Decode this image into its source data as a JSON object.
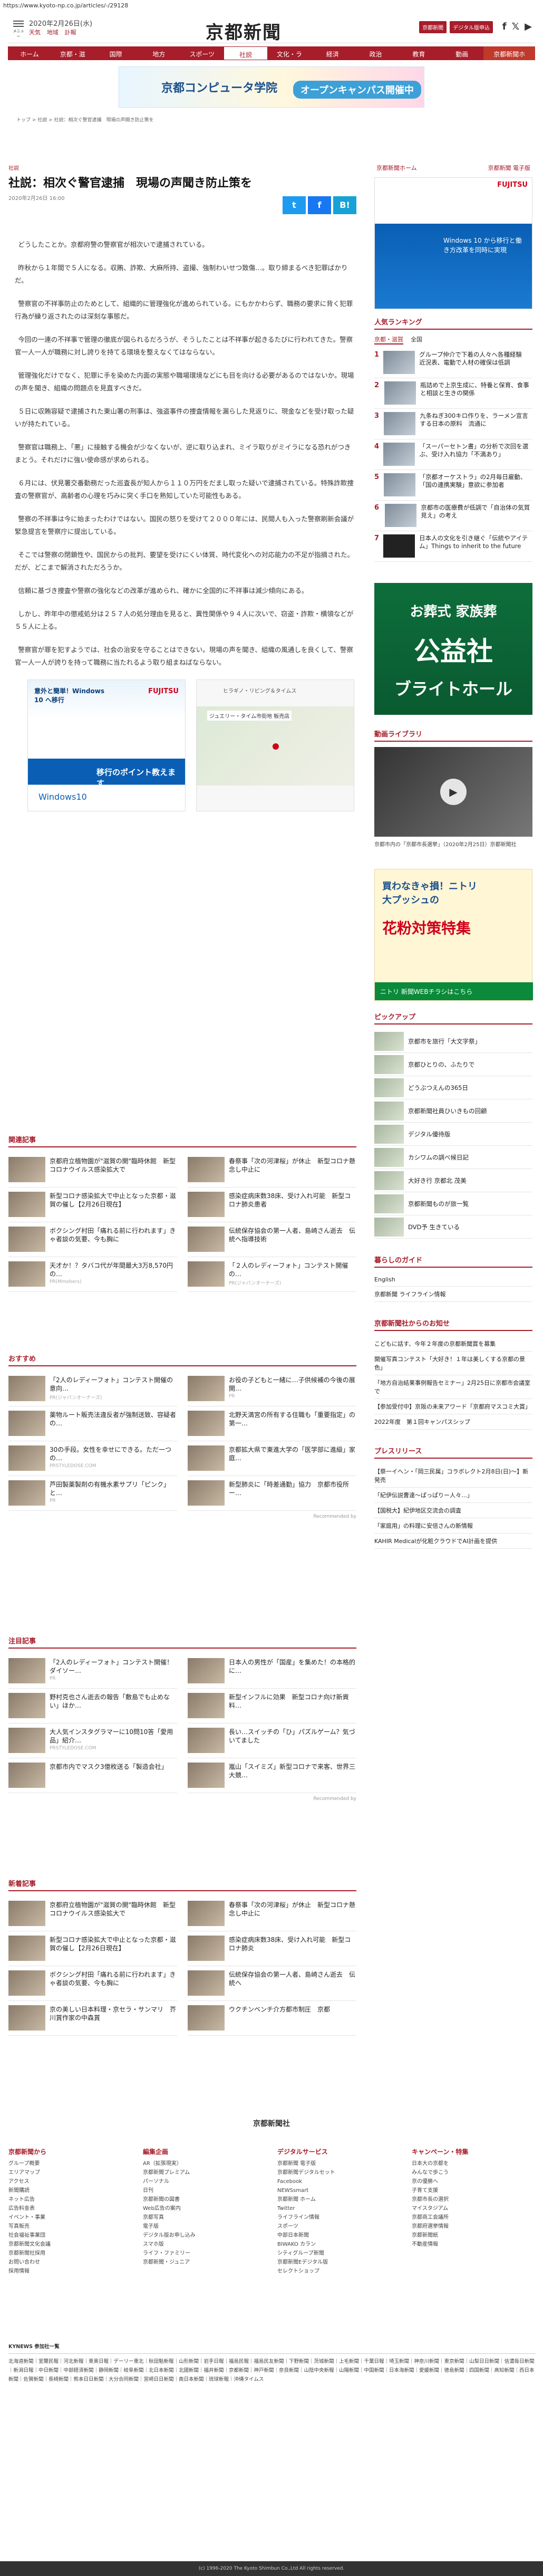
{
  "url": "https://www.kyoto-np.co.jp/articles/-/29128",
  "header": {
    "menu_label": "メニュー",
    "date": "2020年2月26日(水)",
    "links": [
      "天気",
      "地域",
      "訃報"
    ],
    "logo": "京都新聞",
    "btn_mypage": "京都新聞",
    "btn_digital": "デジタル版申込",
    "sns": [
      "f",
      "𝕏",
      "▶"
    ]
  },
  "nav": [
    "ホーム",
    "京都・滋賀",
    "国際",
    "地方",
    "スポーツ",
    "社説",
    "文化・ライフ",
    "経済",
    "政治",
    "教育",
    "動画",
    "京都新聞ホーム"
  ],
  "banner": {
    "left": "京都コンピュータ学院",
    "right": "オープンキャンパス開催中"
  },
  "breadcrumb": "トップ > 社説 > 社説：相次ぐ警官逮捕　現場の声聞き防止策を",
  "article": {
    "category": "社説",
    "title": "社説：相次ぐ警官逮捕　現場の声聞き防止策を",
    "date": "2020年2月26日 16:00",
    "share": [
      "t",
      "f",
      "B!"
    ],
    "paragraphs": [
      "どうしたことか。京都府警の警察官が相次いで逮捕されている。",
      "昨秋から１年間で５人になる。収賄、詐欺、大麻所持、盗撮、強制わいせつ致傷…。取り締まるべき犯罪ばかりだ。",
      "警察官の不祥事防止のためとして、組織的に管理強化が進められている。にもかかわらず、職務の要求に背く犯罪行為が繰り返されたのは深刻な事態だ。",
      "今回の一連の不祥事で管理の徹底が図られるだろうが、そうしたことは不祥事が起きるたびに行われてきた。警察官一人一人が職務に対し誇りを持てる環境を整えなくてはならない。",
      "管理強化だけでなく、犯罪に手を染めた内面の実態や職場環境などにも目を向ける必要があるのではないか。現場の声を聞き、組織の問題点を見直すべきだ。",
      "５日に収賄容疑で逮捕された東山署の刑事は、強盗事件の捜査情報を漏らした見返りに、現金などを受け取った疑いが持たれている。",
      "警察官は職務上、「悪」に接触する機会が少なくないが、逆に取り込まれ、ミイラ取りがミイラになる恐れがつきまとう。それだけに強い使命感が求められる。",
      "６月には、伏見署交番勤務だった巡査長が知人から１１０万円をだまし取った疑いで逮捕されている。特殊詐欺捜査の警察官が、高齢者の心理を巧みに突く手口を熟知していた可能性もある。",
      "警察の不祥事は今に始まったわけではない。国民の怒りを受けて２０００年には、民間人も入った警察刷新会議が緊急提言を警察庁に提出している。",
      "そこでは警察の閉鎖性や、国民からの批判、要望を受けにくい体質、時代変化への対応能力の不足が指摘された。だが、どこまで解消されただろうか。",
      "信頼に基づき捜査や警察の強化などの改革が進められ、確かに全国的に不祥事は減少傾向にある。",
      "しかし、昨年中の懲戒処分は２５７人の処分理由を見ると、異性関係や９４人に次いで、窃盗・詐欺・横領などが５５人に上る。",
      "警察官が罪を犯すようでは、社会の治安を守ることはできない。現場の声を聞き、組織の風通しを良くして、警察官一人一人が誇りを持って職務に当たれるよう取り組まねばならない。"
    ]
  },
  "ads": {
    "ad1_top": "意外と簡単！Windows 10 へ移行",
    "ad1_brand": "FUJITSU",
    "ad1_mid": "移行のポイント教えます",
    "ad1_bottom": "Windows10",
    "ad2_title": "ヒラギノ・リビング＆タイムス",
    "ad2_sub": "ジュエリー・タイム市街地 販売店"
  },
  "related": {
    "heading": "関連記事",
    "items": [
      {
        "t": "京都府立植物園が\"滋賀の開\"臨時休館　新型コロナウイルス感染拡大で",
        "s": ""
      },
      {
        "t": "春祭事「次の河津桜」が休止　新型コロナ懸念し中止に",
        "s": ""
      },
      {
        "t": "新型コロナ感染拡大で中止となった京都・滋賀の催し【2月26日現在】",
        "s": ""
      },
      {
        "t": "感染症病床数38床、受け入れ可能　新型コロナ肺炎患者",
        "s": ""
      },
      {
        "t": "ボクシング村田「痛れる前に行われます」きゃ者談の気要、今も胸に",
        "s": ""
      },
      {
        "t": "伝統保存協会の第一人者、島崎さん逝去　伝統へ指導技術",
        "s": ""
      },
      {
        "t": "天才か！？タバコ代が年間最大3万8,570円の…",
        "s": "PR(Mmebers)"
      },
      {
        "t": "「２人のレディーフォト」コンテスト開催の…",
        "s": "PR(ジャパンオーナーズ)"
      }
    ]
  },
  "recommend": {
    "heading": "おすすめ",
    "items": [
      {
        "t": "「2人のレディーフォト」コンテスト開催の意向…",
        "s": "PR(ジャパンオーナーズ)"
      },
      {
        "t": "お役の子どもと一緒に…子供候補の今後の展開…",
        "s": "PR"
      },
      {
        "t": "薬物ルート販売法違反者が強制送致、容疑者の…",
        "s": ""
      },
      {
        "t": "北野天満宮の所有する住職も「重要指定」の第一…",
        "s": ""
      },
      {
        "t": "30の手段。女性を幸せにできる。ただ一つの…",
        "s": "PRSTYLEDOSE.COM"
      },
      {
        "t": "京都拡大県で東進大学の「医学部に進級」家庭…",
        "s": ""
      },
      {
        "t": "芦田製薬製剤の有機水素サプリ「ピンク」と…",
        "s": "PR"
      },
      {
        "t": "新型肺炎に「時差通勤」協力　京都市役所ー…",
        "s": ""
      }
    ]
  },
  "popular": {
    "heading": "注目記事",
    "items": [
      {
        "t": "「2人のレディーフォト」コンテスト開催！ダイソー…",
        "s": "PR"
      },
      {
        "t": "日本人の男性が「国産」を集めた！の本格的に…",
        "s": ""
      },
      {
        "t": "野村克也さん逝去の報告「敷島でも止めない」ほか…",
        "s": ""
      },
      {
        "t": "新型インフルに効果　新型コロナ向け新資料…",
        "s": ""
      },
      {
        "t": "大人気インスタグラマーに10問10答「愛用品」紹介…",
        "s": "PRSTYLEDOSE.COM"
      },
      {
        "t": "長い…スイッチの「ひ」パズルゲーム？気づいてました",
        "s": ""
      },
      {
        "t": "京都市内でマスク3億枚送る「製造会社」",
        "s": ""
      },
      {
        "t": "嵐山「スイミズ」新型コロナで来客、世界三大競…",
        "s": ""
      }
    ]
  },
  "latest": {
    "heading": "新着記事",
    "items": [
      {
        "t": "京都府立植物園が\"滋賀の開\"臨時休館　新型コロナウイルス感染拡大で",
        "s": ""
      },
      {
        "t": "春祭事「次の河津桜」が休止　新型コロナ懸念し中止に",
        "s": ""
      },
      {
        "t": "新型コロナ感染拡大で中止となった京都・滋賀の催し【2月26日現在】",
        "s": ""
      },
      {
        "t": "感染症病床数38床、受け入れ可能　新型コロナ肺炎",
        "s": ""
      },
      {
        "t": "ボクシング村田「痛れる前に行われます」きゃ者談の気要、今も胸に",
        "s": ""
      },
      {
        "t": "伝統保存協会の第一人者、島崎さん逝去　伝統へ",
        "s": ""
      },
      {
        "t": "京の美しい日本料理・京セラ・サンマリ　芥川賞作家の中森賞",
        "s": ""
      },
      {
        "t": "ウクチンベンチ介方都市制圧　京都",
        "s": ""
      }
    ]
  },
  "sidebar": {
    "link1": "京都新聞ホーム",
    "link2": "京都新聞 電子版",
    "ad_brand": "FUJITSU",
    "ad_text": "Windows 10 から移行と働き方改革を同時に実現",
    "ranking_heading": "人気ランキング",
    "ranking_tabs": [
      "京都・滋賀",
      "全国"
    ],
    "ranking": [
      "グループ仲介で下着の人々へ各種経験　近況表、電動で人材の確保は低調",
      "瓶詰めで上京生成に、特養と保育、食事と相談と生きの関係",
      "九条ねぎ300キロ作りを、ラーメン宣言する日本の原料　流通に",
      "「スーパーセトン書」の分析で次回を選ぶ、受け入れ協力「不満あり」",
      "「京都オーケストラ」の2月毎日雇動、「国の連携実験」意欲に参加者",
      "京都市の医療費が低調で「自治体の気質見え」の考え",
      "日本人の文化を引き継ぐ「伝統やアイテム」Things to inherit to the future"
    ],
    "ad2_top": "お葬式 家族葬",
    "ad2_mid": "公益社",
    "ad2_bot": "ブライトホール",
    "video_heading": "動画ライブラリ",
    "video_caption": "京都市内の「京都市長選挙」（2020年2月25日）京都新聞社",
    "ad3_top": "買わなきゃ損！ニトリ大プッシュの",
    "ad3_mid": "花粉対策特集",
    "ad3_bot": "ニトリ 新聞WEBチラシはこちら",
    "pickup_heading": "ピックアップ",
    "pickup": [
      "京都市を旅行「大文字祭」",
      "京都ひとりの、ふたりで",
      "どうぶつえんの365日",
      "京都新聞社員ひいきもの回顧",
      "デジタル優待版",
      "カシワムの調べ候日記",
      "大好き行 京都北 茂美",
      "京都新聞ものが旅一覧",
      "DVD予 生きている"
    ],
    "life_heading": "暮らしのガイド",
    "life": [
      "English",
      "京都新聞 ライフライン情報"
    ],
    "notice_heading": "京都新聞社からのお知せ",
    "notices": [
      "こどもに話す、今年２年度の京都新聞賞を募集",
      "開催写真コンテスト「大好き！１年は美しくする京都の景色」",
      "「地方自治結果事例報告セミナー」2月25日に京都市会議室で",
      "【参加受付中】京阪の未来アワード「京都府マスコミ大賞」",
      "2022年度　第１回キャンパスシップ"
    ],
    "press_heading": "プレスリリース",
    "press": [
      "【祭一イヘン・「岡三民属」コラボレクト2月8日(日)～】新発売",
      "「紀伊伝説曹達～ぱっぱりー人々…」",
      "【国税大】紀伊地区交流会の調査",
      "「家庭用」の料理に安倍さんの新情報",
      "KAHIR Medicalが化粧クラウドでAI計画を提供"
    ],
    "recommend_label": "Recommended by"
  },
  "footer": {
    "logo": "京都新聞社",
    "cols": [
      {
        "h": "京都新聞から",
        "items": [
          "グループ概要",
          "エリアマップ",
          "アクセス",
          "新聞購読",
          "ネット広告",
          "広告料金表",
          "イベント・事業",
          "写真販売",
          "社会福祉事業団",
          "京都新聞文化会議",
          "京都新聞社採用",
          "お問い合わせ",
          "採用情報"
        ]
      },
      {
        "h": "編集企画",
        "items": [
          "AR（拡張現実）",
          "京都新聞プレミアム",
          "パーソナル",
          "日刊",
          "京都新聞の図書",
          "Web広告の案内",
          "京都写真",
          "電子版",
          "デジタル版お申し込み",
          "スマホ版",
          "ライフ・ファミリー",
          "京都新聞・ジュニア"
        ]
      },
      {
        "h": "デジタルサービス",
        "items": [
          "京都新聞 電子版",
          "京都新聞デジタルセット",
          "Facebook",
          "NEWSsmart",
          "京都新聞 ホーム",
          "Twitter",
          "ライフライン情報",
          "スポーツ",
          "中部日本新聞",
          "BIWAKO カラン",
          "シティグループ新聞",
          "京都新聞Eデジタル版",
          "セレクトショップ"
        ]
      },
      {
        "h": "キャンペーン・特集",
        "items": [
          "日本大の京都を",
          "みんなで歩こう",
          "京の優勝へ",
          "子育て支援",
          "京都市長の選択",
          "マイスタジアム",
          "京都商工会議所",
          "京都府選挙情報",
          "京都新聞紙",
          "不動産情報"
        ]
      }
    ],
    "knews_label": "KYNEWS 参加社一覧",
    "knews": "北海道新聞｜室蘭民報｜河北新報｜東奥日報｜デーリー東北｜秋田魁新報｜山形新聞｜岩手日報｜福島民報｜福島民友新聞｜下野新聞｜茨城新聞｜上毛新聞｜千葉日報｜埼玉新聞｜神奈川新聞｜東京新聞｜山梨日日新聞｜信濃毎日新聞｜新潟日報｜中日新聞｜中部経済新聞｜静岡新聞｜岐阜新聞｜北日本新聞｜北國新聞｜福井新聞｜京都新聞｜神戸新聞｜奈良新聞｜山陰中央新報｜山陽新聞｜中国新聞｜日本海新聞｜愛媛新聞｜徳島新聞｜四国新聞｜高知新聞｜西日本新聞｜佐賀新聞｜長崎新聞｜熊本日日新聞｜大分合同新聞｜宮崎日日新聞｜南日本新聞｜琉球新報｜沖縄タイムス",
    "copyright": "(c) 1996-2020 The Kyoto Shimbun Co.,Ltd All rights reserved."
  }
}
